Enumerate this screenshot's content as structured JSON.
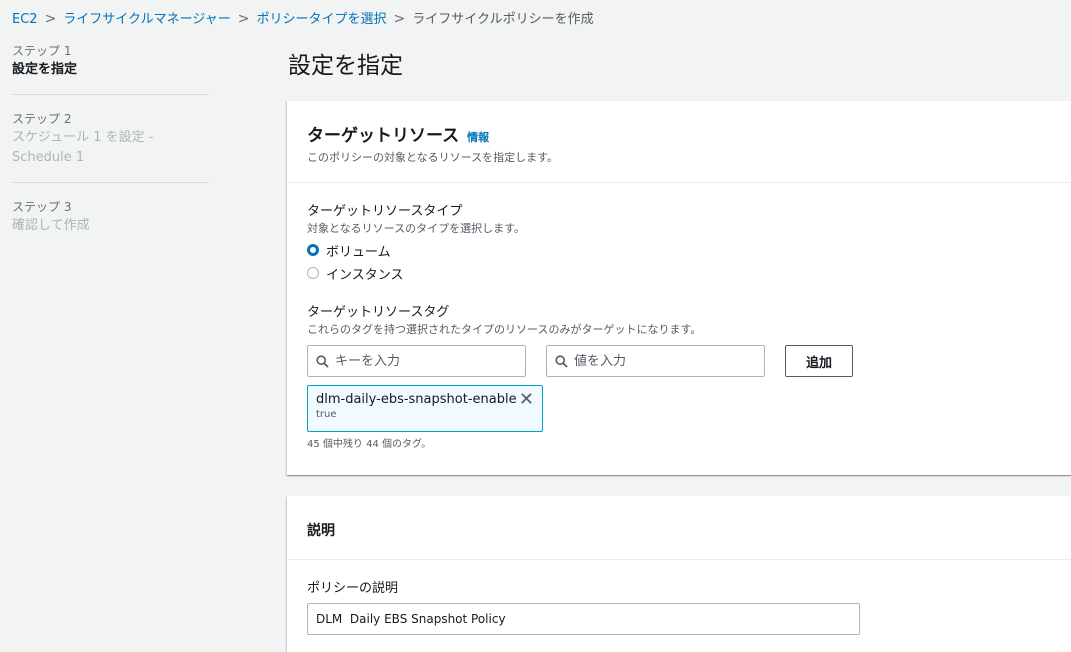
{
  "breadcrumb": [
    "EC2",
    "ライフサイクルマネージャー",
    "ポリシータイプを選択",
    "ライフサイクルポリシーを作成"
  ],
  "steps": [
    {
      "num": "ステップ 1",
      "title": "設定を指定"
    },
    {
      "num": "ステップ 2",
      "title": "スケジュール 1 を設定 - Schedule 1"
    },
    {
      "num": "ステップ 3",
      "title": "確認して作成"
    }
  ],
  "page_title": "設定を指定",
  "target": {
    "title": "ターゲットリソース",
    "info": "情報",
    "description": "このポリシーの対象となるリソースを指定します。",
    "type_label": "ターゲットリソースタイプ",
    "type_sub": "対象となるリソースのタイプを選択します。",
    "options": [
      "ボリューム",
      "インスタンス"
    ],
    "selected": "ボリューム",
    "tags_label": "ターゲットリソースタグ",
    "tags_sub": "これらのタグを持つ選択されたタイプのリソースのみがターゲットになります。",
    "key_placeholder": "キーを入力",
    "value_placeholder": "値を入力",
    "add_label": "追加",
    "tag_key": "dlm-daily-ebs-snapshot-enable",
    "tag_value": "true",
    "tag_count": "45 個中残り 44 個のタグ。"
  },
  "description_section": {
    "title": "説明",
    "label": "ポリシーの説明",
    "value": "DLM  Daily EBS Snapshot Policy"
  },
  "colors": {
    "link": "#0073bb",
    "token_bg": "#f1faff",
    "token_border": "#00a1c9"
  }
}
